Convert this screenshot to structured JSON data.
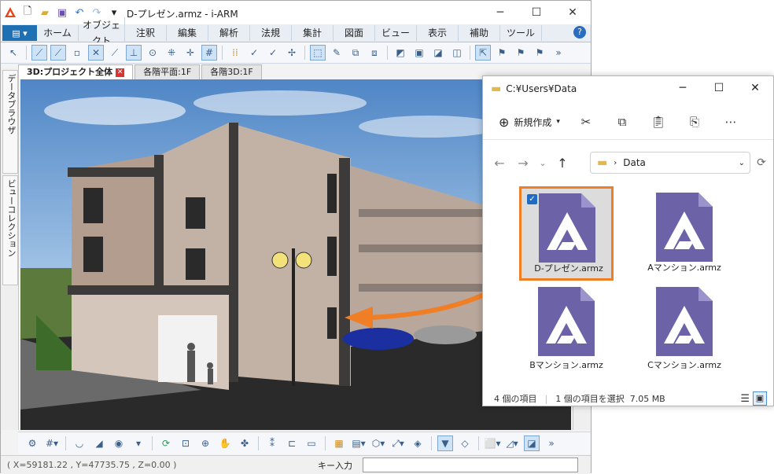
{
  "app": {
    "title": "D-プレゼン.armz - i-ARM",
    "menus": [
      "ホーム",
      "オブジェクト",
      "注釈",
      "編集",
      "解析",
      "法規",
      "集計",
      "図面",
      "ビュー",
      "表示",
      "補助",
      "ツール"
    ],
    "help_icon": "help-icon",
    "tabs": [
      {
        "label": "3D:プロジェクト全体",
        "active": true
      },
      {
        "label": "各階平面:1F",
        "active": false
      },
      {
        "label": "各階3D:1F",
        "active": false
      }
    ],
    "side_tabs": [
      "データブラウザ",
      "ビューコレクション"
    ],
    "status": {
      "coords": "( X=59181.22 , Y=47735.75 , Z=0.00 )",
      "key_input_label": "キー入力"
    }
  },
  "explorer": {
    "title": "C:¥Users¥Data",
    "new_label": "新規作成",
    "address": "Data",
    "files": [
      {
        "name": "D-プレゼン.armz",
        "selected": true
      },
      {
        "name": "Aマンション.armz",
        "selected": false
      },
      {
        "name": "Bマンション.armz",
        "selected": false
      },
      {
        "name": "Cマンション.armz",
        "selected": false
      }
    ],
    "status_items": "4 個の項目",
    "status_selected": "1 個の項目を選択  7.05 MB"
  },
  "colors": {
    "accent": "#f07e25",
    "file_icon": "#6b62a8",
    "app_blue": "#1f6fb3"
  }
}
